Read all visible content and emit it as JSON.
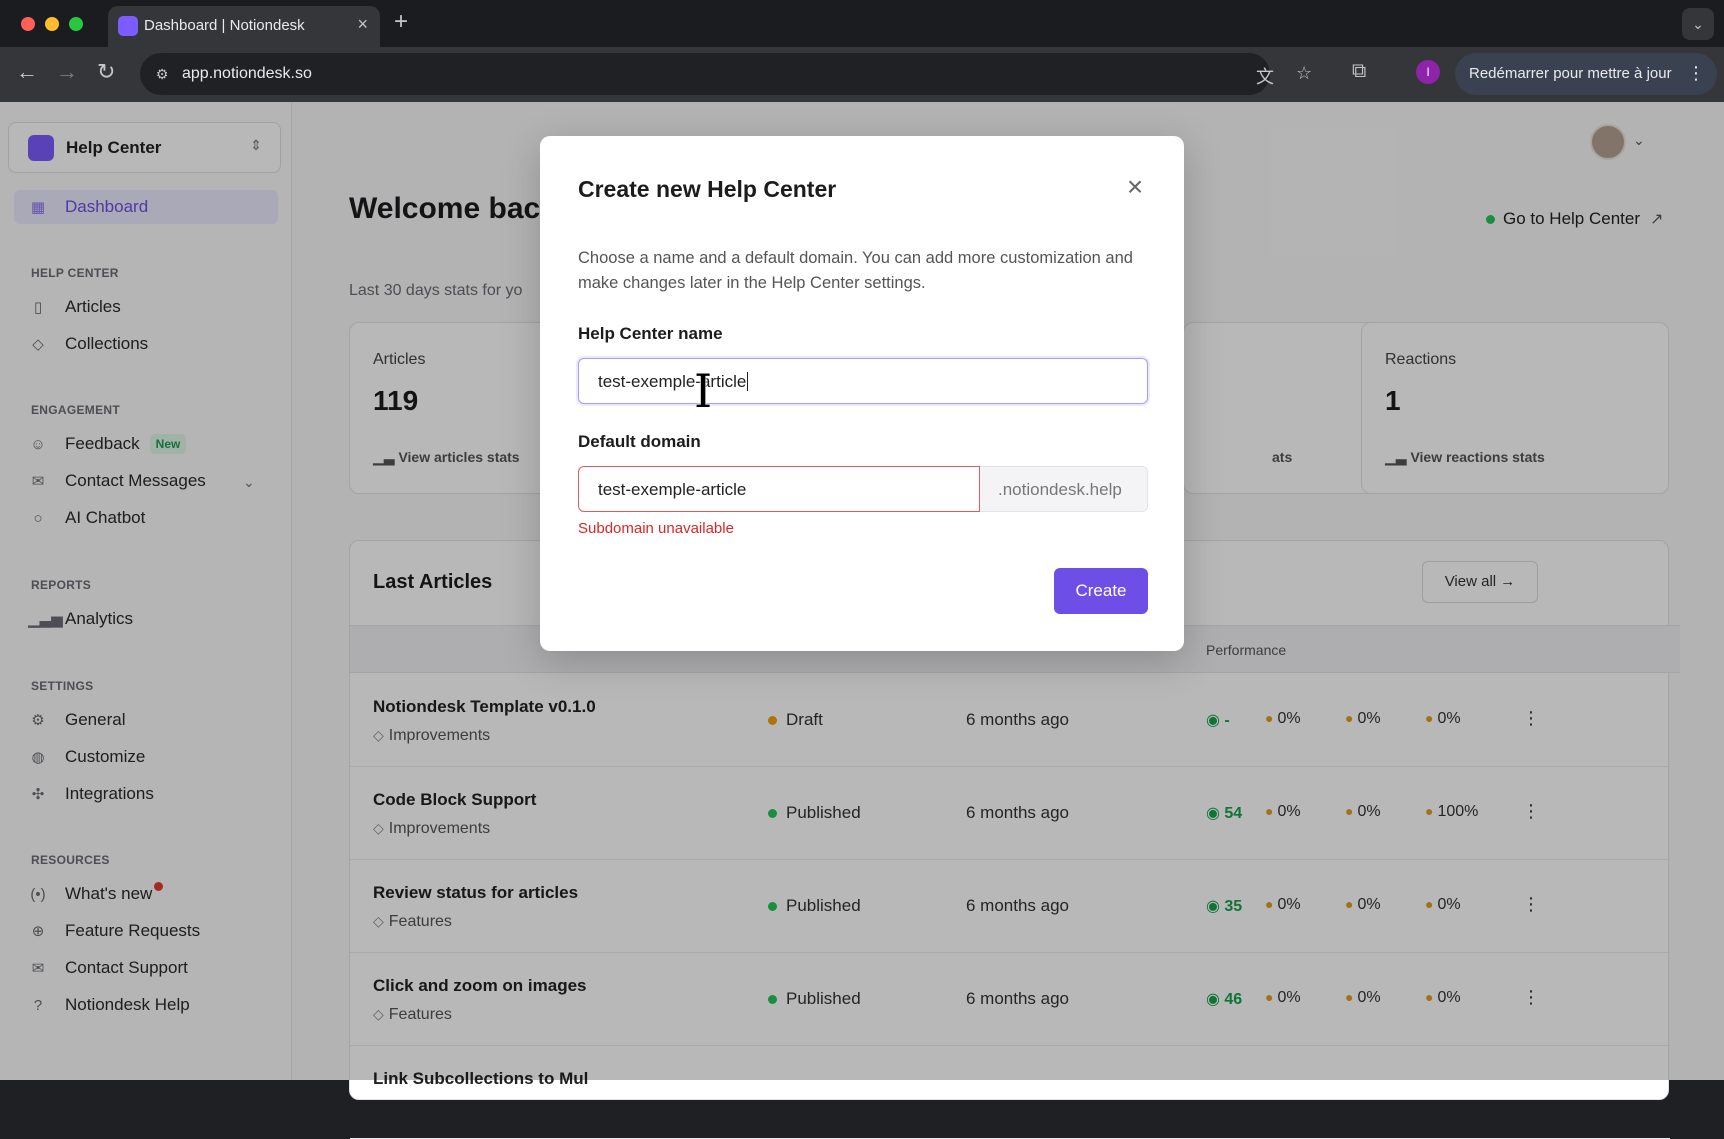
{
  "browser": {
    "tab_title": "Dashboard | Notiondesk",
    "url": "app.notiondesk.so",
    "profile_initial": "I",
    "relaunch_label": "Redémarrer pour mettre à jour"
  },
  "sidebar": {
    "workspace": "Help Center",
    "dashboard": "Dashboard",
    "sections": {
      "help_center": "HELP CENTER",
      "engagement": "ENGAGEMENT",
      "reports": "REPORTS",
      "settings": "SETTINGS",
      "resources": "RESOURCES"
    },
    "items": {
      "articles": "Articles",
      "collections": "Collections",
      "feedback": "Feedback",
      "feedback_badge": "New",
      "contact_messages": "Contact Messages",
      "ai_chatbot": "AI Chatbot",
      "analytics": "Analytics",
      "general": "General",
      "customize": "Customize",
      "integrations": "Integrations",
      "whats_new": "What's new",
      "feature_requests": "Feature Requests",
      "contact_support": "Contact Support",
      "notiondesk_help": "Notiondesk Help"
    }
  },
  "main": {
    "welcome": "Welcome back",
    "goto_label": "Go to Help Center",
    "subtitle": "Last 30 days stats for yo",
    "cards": {
      "articles_label": "Articles",
      "articles_value": "119",
      "articles_link": "View articles stats",
      "partial_link": "ats",
      "reactions_label": "Reactions",
      "reactions_value": "1",
      "reactions_link": "View reactions stats"
    },
    "last_articles": {
      "title": "Last Articles",
      "view_all": "View all →",
      "performance_header": "Performance",
      "rows": [
        {
          "title": "Notiondesk Template v0.1.0",
          "tag": "Improvements",
          "status": "Draft",
          "ago": "6 months ago",
          "views": "-",
          "r1": "0%",
          "r2": "0%",
          "r3": "0%"
        },
        {
          "title": "Code Block Support",
          "tag": "Improvements",
          "status": "Published",
          "ago": "6 months ago",
          "views": "54",
          "r1": "0%",
          "r2": "0%",
          "r3": "100%"
        },
        {
          "title": "Review status for articles",
          "tag": "Features",
          "status": "Published",
          "ago": "6 months ago",
          "views": "35",
          "r1": "0%",
          "r2": "0%",
          "r3": "0%"
        },
        {
          "title": "Click and zoom on images",
          "tag": "Features",
          "status": "Published",
          "ago": "6 months ago",
          "views": "46",
          "r1": "0%",
          "r2": "0%",
          "r3": "0%"
        },
        {
          "title": "Link Subcollections to Mul",
          "tag": "",
          "status": "",
          "ago": "",
          "views": "",
          "r1": "",
          "r2": "",
          "r3": ""
        }
      ]
    }
  },
  "modal": {
    "title": "Create new Help Center",
    "description": "Choose a name and a default domain. You can add more customization and make changes later in the Help Center settings.",
    "name_label": "Help Center name",
    "name_value": "test-exemple-article",
    "domain_label": "Default domain",
    "domain_value": "test-exemple-article",
    "domain_suffix": ".notiondesk.help",
    "error": "Subdomain unavailable",
    "create_label": "Create"
  },
  "colors": {
    "accent": "#6d4fe8",
    "draft": "#f59e0b",
    "published": "#22c55e",
    "error": "#dc2626"
  }
}
